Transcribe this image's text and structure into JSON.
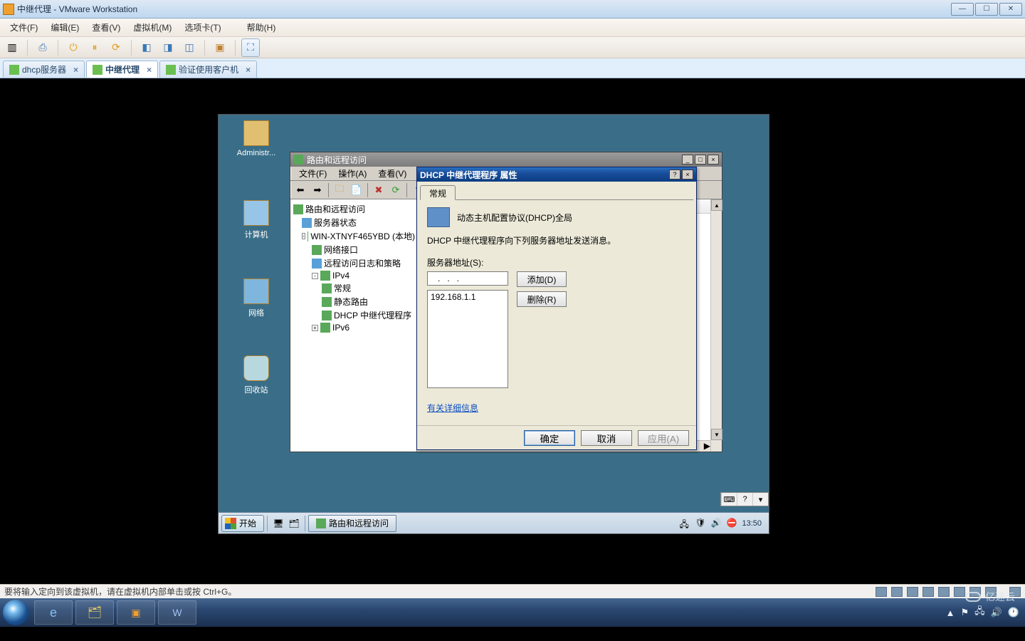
{
  "host": {
    "title": "中继代理 - VMware Workstation",
    "status_text": "要将输入定向到该虚拟机，请在虚拟机内部单击或按 Ctrl+G。",
    "watermark": "亿速云"
  },
  "menus": {
    "file": "文件(F)",
    "edit": "编辑(E)",
    "view": "查看(V)",
    "vm": "虚拟机(M)",
    "tabs": "选项卡(T)",
    "help": "帮助(H)"
  },
  "tabs": {
    "items": [
      {
        "label": "dhcp服务器",
        "active": false
      },
      {
        "label": "中继代理",
        "active": true
      },
      {
        "label": "验证使用客户机",
        "active": false
      }
    ]
  },
  "desktop": {
    "admin": "Administr...",
    "computer": "计算机",
    "network": "网络",
    "recycle": "回收站"
  },
  "mmc": {
    "title": "路由和远程访问",
    "menu_file": "文件(F)",
    "menu_action": "操作(A)",
    "menu_view": "查看(V)",
    "tree": {
      "root": "路由和远程访问",
      "status": "服务器状态",
      "server": "WIN-XTNYF465YBD (本地)",
      "nic": "网络接口",
      "log": "远程访问日志和策略",
      "ipv4": "IPv4",
      "general": "常规",
      "static": "静态路由",
      "dhcp_relay": "DHCP 中继代理程序",
      "ipv6": "IPv6"
    }
  },
  "dialog": {
    "title": "DHCP 中继代理程序 属性",
    "tab": "常规",
    "heading": "动态主机配置协议(DHCP)全局",
    "desc": "DHCP 中继代理程序向下列服务器地址发送消息。",
    "server_addr_label": "服务器地址(S):",
    "input_value": "   .   .   .   ",
    "add": "添加(D)",
    "remove": "删除(R)",
    "list_item": "192.168.1.1",
    "more_info": "有关详细信息",
    "ok": "确定",
    "cancel": "取消",
    "apply": "应用(A)"
  },
  "guest_taskbar": {
    "start": "开始",
    "task": "路由和远程访问",
    "clock": "13:50"
  },
  "guest_topbar": {
    "tip1": "?",
    "tip2": "▬"
  }
}
